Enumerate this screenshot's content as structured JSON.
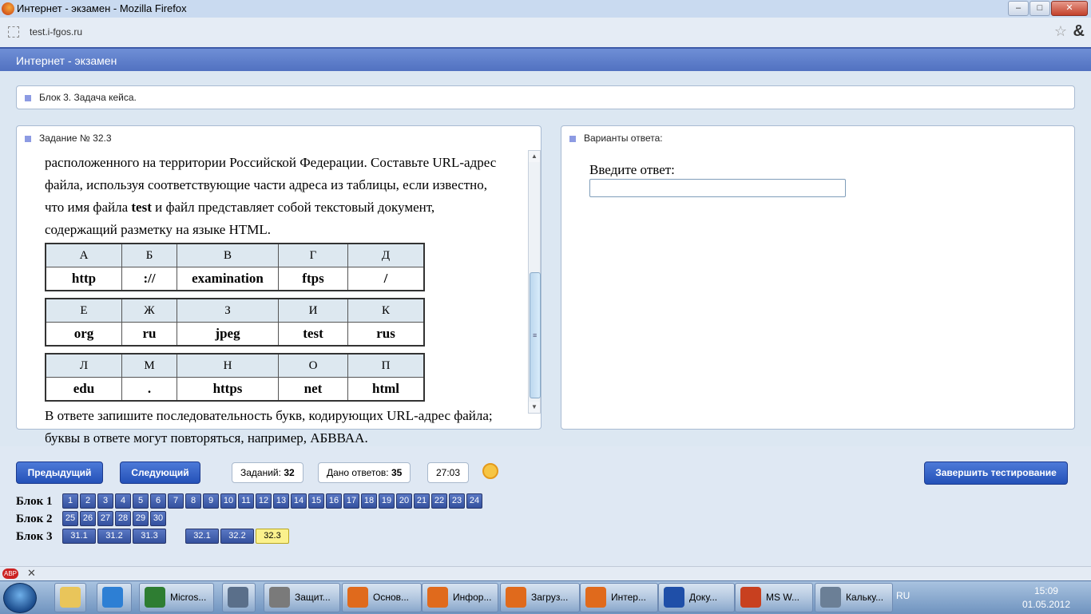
{
  "window": {
    "title": "Интернет - экзамен - Mozilla Firefox",
    "minimize": "–",
    "maximize": "□",
    "close": "✕"
  },
  "addressbar": {
    "url": "test.i-fgos.ru",
    "star": "☆",
    "amp": "&"
  },
  "header": {
    "title": "Интернет - экзамен"
  },
  "block_panel": {
    "title": "Блок 3. Задача кейса."
  },
  "task": {
    "title": "Задание № 32.3",
    "para1": "расположенного на территории Российской Федерации. Составьте URL-адрес файла, используя соответствующие части адреса из таблицы, если известно, что имя файла",
    "para1_bold": "test",
    "para1_end": "и файл представляет собой текстовый документ, содержащий разметку на языке HTML.",
    "tables": [
      {
        "letters": [
          "А",
          "Б",
          "В",
          "Г",
          "Д"
        ],
        "values": [
          "http",
          "://",
          "examination",
          "ftps",
          "/"
        ]
      },
      {
        "letters": [
          "Е",
          "Ж",
          "З",
          "И",
          "К"
        ],
        "values": [
          "org",
          "ru",
          "jpeg",
          "test",
          "rus"
        ]
      },
      {
        "letters": [
          "Л",
          "М",
          "Н",
          "О",
          "П"
        ],
        "values": [
          "edu",
          ".",
          "https",
          "net",
          "html"
        ]
      }
    ],
    "para2": "В ответе запишите последовательность букв, кодирующих URL-адрес файла; буквы в ответе могут повторяться, например, АБВВАА."
  },
  "answer_panel": {
    "title": "Варианты ответа:",
    "label": "Введите ответ:",
    "value": ""
  },
  "controls": {
    "prev": "Предыдущий",
    "next": "Следующий",
    "tasks_label": "Заданий:",
    "tasks_count": "32",
    "answers_label": "Дано ответов:",
    "answers_count": "35",
    "timer": "27:03",
    "finish": "Завершить тестирование"
  },
  "nav": {
    "block1_label": "Блок 1",
    "block1": [
      "1",
      "2",
      "3",
      "4",
      "5",
      "6",
      "7",
      "8",
      "9",
      "10",
      "11",
      "12",
      "13",
      "14",
      "15",
      "16",
      "17",
      "18",
      "19",
      "20",
      "21",
      "22",
      "23",
      "24"
    ],
    "block2_label": "Блок 2",
    "block2": [
      "25",
      "26",
      "27",
      "28",
      "29",
      "30"
    ],
    "block3_label": "Блок 3",
    "block3_a": [
      "31.1",
      "31.2",
      "31.3"
    ],
    "block3_b": [
      "32.1",
      "32.2",
      "32.3"
    ],
    "active": "32.3"
  },
  "taskbar": {
    "items": [
      {
        "label": "Micros...",
        "color": "#2e7d32"
      },
      {
        "label": "",
        "color": "#5a6f8a"
      },
      {
        "label": "Защит...",
        "color": "#7a7a7a"
      },
      {
        "label": "Основ...",
        "color": "#e06a1c"
      },
      {
        "label": "Инфор...",
        "color": "#e06a1c"
      },
      {
        "label": "Загруз...",
        "color": "#e06a1c"
      },
      {
        "label": "Интер...",
        "color": "#e06a1c"
      },
      {
        "label": "Доку...",
        "color": "#1f4fa8"
      },
      {
        "label": "MS W...",
        "color": "#c8401f"
      },
      {
        "label": "Кальку...",
        "color": "#6b7f96"
      }
    ],
    "lang": "RU",
    "time": "15:09",
    "date": "01.05.2012"
  },
  "addon": {
    "abp": "ABP",
    "close": "✕"
  }
}
